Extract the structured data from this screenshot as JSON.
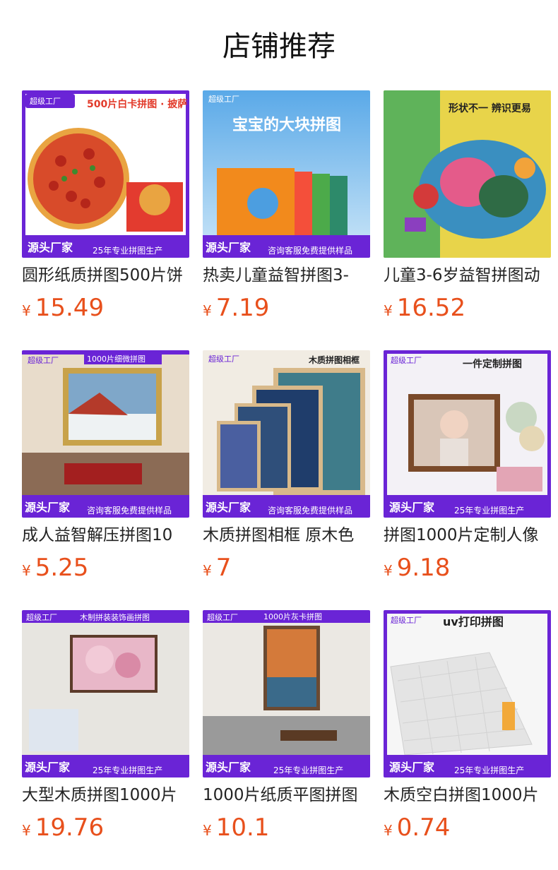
{
  "page_title": "店铺推荐",
  "products": [
    {
      "name": "圆形纸质拼图500片饼",
      "currency": "¥",
      "price": "15.49",
      "banner_left": "源头厂家",
      "banner_right": "25年专业拼图生产",
      "badge": "超级工厂",
      "tagline": "500片白卡拼图 · 披萨"
    },
    {
      "name": "热卖儿童益智拼图3-",
      "currency": "¥",
      "price": "7.19",
      "banner_left": "源头厂家",
      "banner_right": "咨询客服免费提供样品",
      "badge": "超级工厂",
      "tagline": "宝宝的大块拼图"
    },
    {
      "name": "儿童3-6岁益智拼图动",
      "currency": "¥",
      "price": "16.52",
      "banner_left": "",
      "banner_right": "",
      "badge": "",
      "tagline": "形状不一 辨识更易"
    },
    {
      "name": "成人益智解压拼图10",
      "currency": "¥",
      "price": "5.25",
      "banner_left": "源头厂家",
      "banner_right": "咨询客服免费提供样品",
      "badge": "超级工厂",
      "tagline": "1000片细微拼图"
    },
    {
      "name": "木质拼图相框 原木色",
      "currency": "¥",
      "price": "7",
      "banner_left": "源头厂家",
      "banner_right": "咨询客服免费提供样品",
      "badge": "超级工厂",
      "tagline": "木质拼图相框"
    },
    {
      "name": "拼图1000片定制人像",
      "currency": "¥",
      "price": "9.18",
      "banner_left": "源头厂家",
      "banner_right": "25年专业拼图生产",
      "badge": "超级工厂",
      "tagline": "一件定制拼图"
    },
    {
      "name": "大型木质拼图1000片",
      "currency": "¥",
      "price": "19.76",
      "banner_left": "源头厂家",
      "banner_right": "25年专业拼图生产",
      "badge": "超级工厂",
      "tagline": "木制拼装装饰画拼图"
    },
    {
      "name": "1000片纸质平图拼图",
      "currency": "¥",
      "price": "10.1",
      "banner_left": "源头厂家",
      "banner_right": "25年专业拼图生产",
      "badge": "超级工厂",
      "tagline": "1000片灰卡拼图"
    },
    {
      "name": "木质空白拼图1000片",
      "currency": "¥",
      "price": "0.74",
      "banner_left": "源头厂家",
      "banner_right": "25年专业拼图生产",
      "badge": "超级工厂",
      "tagline": "uv打印拼图"
    }
  ],
  "colors": {
    "accent_price": "#e8501c",
    "brand_purple": "#6a24d6"
  }
}
